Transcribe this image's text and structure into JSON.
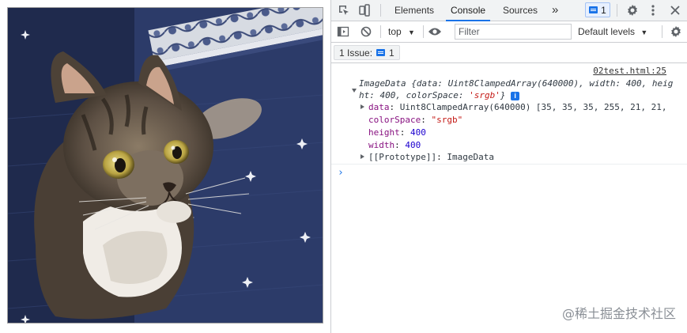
{
  "devtools": {
    "tabs": [
      {
        "label": "Elements",
        "active": false
      },
      {
        "label": "Console",
        "active": true
      },
      {
        "label": "Sources",
        "active": false
      }
    ],
    "more_tabs_glyph": "»",
    "issues_count": "1"
  },
  "console_toolbar": {
    "context": "top",
    "filter_placeholder": "Filter",
    "levels": "Default levels"
  },
  "issues_bar": {
    "label": "1 Issue:",
    "count": "1"
  },
  "console": {
    "source_link": "02test.html:25",
    "summary_line1": "ImageData {data: Uint8ClampedArray(640000), width: 400, heig",
    "summary_line2_a": "ht: 400, colorSpace: ",
    "summary_line2_b": "'srgb'",
    "summary_line2_c": "}",
    "info_glyph": "i",
    "props": {
      "data_key": "data",
      "data_value": "Uint8ClampedArray(640000) [35, 35, 35, 255, 21, 21, ",
      "colorspace_key": "colorSpace",
      "colorspace_value": "\"srgb\"",
      "height_key": "height",
      "height_value": "400",
      "width_key": "width",
      "width_value": "400",
      "proto_key": "[[Prototype]]",
      "proto_value": "ImageData"
    },
    "prompt": "›"
  },
  "canvas": {
    "content": "cat photo on patterned blanket"
  },
  "watermark": "@稀土掘金技术社区",
  "colors": {
    "accent": "#1a73e8",
    "blanket": "#2b3a68",
    "fur_light": "#f0ece6",
    "eye": "#c7b24a"
  }
}
